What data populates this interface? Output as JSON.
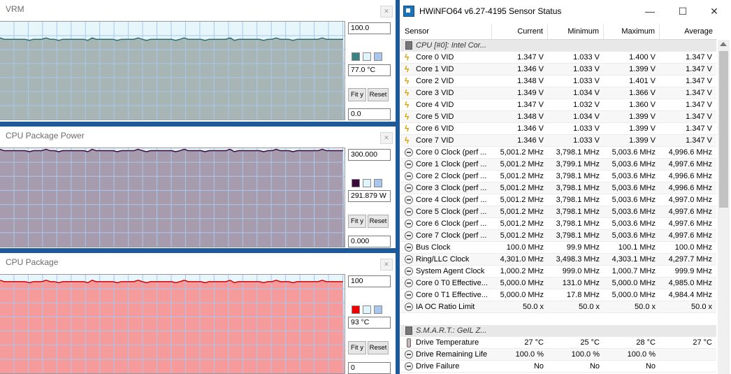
{
  "graphs": [
    {
      "title": "VRM",
      "max_box": "100.0",
      "cur_box": "77.0 °C",
      "min_box": "0.0",
      "fit_label": "Fit y",
      "reset_label": "Reset",
      "fill": "#a7b6b4",
      "line": "#2d6b68",
      "grid_bg": "#e6f6fb",
      "level": 0.82,
      "swatches": [
        "#3a8483",
        "#dff4fb",
        "#a9c7ee"
      ]
    },
    {
      "title": "CPU Package Power",
      "max_box": "300.000",
      "cur_box": "291.879 W",
      "min_box": "0.000",
      "fit_label": "Fit y",
      "reset_label": "Reset",
      "fill": "#a79cae",
      "line": "#3b0a3d",
      "grid_bg": "#e6f6fb",
      "level": 0.975,
      "swatches": [
        "#3b0a3d",
        "#dff4fb",
        "#a9c7ee"
      ]
    },
    {
      "title": "CPU Package",
      "max_box": "100",
      "cur_box": "93 °C",
      "min_box": "0",
      "fit_label": "Fit y",
      "reset_label": "Reset",
      "fill": "#f59b9b",
      "line": "#d10000",
      "grid_bg": "#e6f6fb",
      "level": 0.93,
      "swatches": [
        "#ee0000",
        "#dff4fb",
        "#a9c7ee"
      ]
    }
  ],
  "sensor": {
    "title": "HWiNFO64 v6.27-4195 Sensor Status",
    "columns": [
      "Sensor",
      "Current",
      "Minimum",
      "Maximum",
      "Average"
    ],
    "rows": [
      {
        "kind": "group",
        "icon": "chip",
        "name": "CPU [#0]: Intel Cor..."
      },
      {
        "kind": "row",
        "icon": "volt",
        "name": "Core 0 VID",
        "cur": "1.347 V",
        "min": "1.033 V",
        "max": "1.400 V",
        "avg": "1.347 V"
      },
      {
        "kind": "row",
        "icon": "volt",
        "name": "Core 1 VID",
        "cur": "1.346 V",
        "min": "1.033 V",
        "max": "1.399 V",
        "avg": "1.347 V"
      },
      {
        "kind": "row",
        "icon": "volt",
        "name": "Core 2 VID",
        "cur": "1.348 V",
        "min": "1.033 V",
        "max": "1.401 V",
        "avg": "1.347 V"
      },
      {
        "kind": "row",
        "icon": "volt",
        "name": "Core 3 VID",
        "cur": "1.349 V",
        "min": "1.034 V",
        "max": "1.366 V",
        "avg": "1.347 V"
      },
      {
        "kind": "row",
        "icon": "volt",
        "name": "Core 4 VID",
        "cur": "1.347 V",
        "min": "1.032 V",
        "max": "1.360 V",
        "avg": "1.347 V"
      },
      {
        "kind": "row",
        "icon": "volt",
        "name": "Core 5 VID",
        "cur": "1.348 V",
        "min": "1.034 V",
        "max": "1.399 V",
        "avg": "1.347 V"
      },
      {
        "kind": "row",
        "icon": "volt",
        "name": "Core 6 VID",
        "cur": "1.346 V",
        "min": "1.033 V",
        "max": "1.399 V",
        "avg": "1.347 V"
      },
      {
        "kind": "row",
        "icon": "volt",
        "name": "Core 7 VID",
        "cur": "1.346 V",
        "min": "1.033 V",
        "max": "1.399 V",
        "avg": "1.347 V"
      },
      {
        "kind": "row",
        "icon": "clock",
        "name": "Core 0 Clock (perf ...",
        "cur": "5,001.2 MHz",
        "min": "3,798.1 MHz",
        "max": "5,003.6 MHz",
        "avg": "4,996.6 MHz"
      },
      {
        "kind": "row",
        "icon": "clock",
        "name": "Core 1 Clock (perf ...",
        "cur": "5,001.2 MHz",
        "min": "3,799.1 MHz",
        "max": "5,003.6 MHz",
        "avg": "4,997.6 MHz"
      },
      {
        "kind": "row",
        "icon": "clock",
        "name": "Core 2 Clock (perf ...",
        "cur": "5,001.2 MHz",
        "min": "3,798.1 MHz",
        "max": "5,003.6 MHz",
        "avg": "4,996.6 MHz"
      },
      {
        "kind": "row",
        "icon": "clock",
        "name": "Core 3 Clock (perf ...",
        "cur": "5,001.2 MHz",
        "min": "3,798.1 MHz",
        "max": "5,003.6 MHz",
        "avg": "4,996.6 MHz"
      },
      {
        "kind": "row",
        "icon": "clock",
        "name": "Core 4 Clock (perf ...",
        "cur": "5,001.2 MHz",
        "min": "3,798.1 MHz",
        "max": "5,003.6 MHz",
        "avg": "4,997.0 MHz"
      },
      {
        "kind": "row",
        "icon": "clock",
        "name": "Core 5 Clock (perf ...",
        "cur": "5,001.2 MHz",
        "min": "3,798.1 MHz",
        "max": "5,003.6 MHz",
        "avg": "4,997.6 MHz"
      },
      {
        "kind": "row",
        "icon": "clock",
        "name": "Core 6 Clock (perf ...",
        "cur": "5,001.2 MHz",
        "min": "3,798.1 MHz",
        "max": "5,003.6 MHz",
        "avg": "4,997.6 MHz"
      },
      {
        "kind": "row",
        "icon": "clock",
        "name": "Core 7 Clock (perf ...",
        "cur": "5,001.2 MHz",
        "min": "3,798.1 MHz",
        "max": "5,003.6 MHz",
        "avg": "4,997.6 MHz"
      },
      {
        "kind": "row",
        "icon": "clock",
        "name": "Bus Clock",
        "cur": "100.0 MHz",
        "min": "99.9 MHz",
        "max": "100.1 MHz",
        "avg": "100.0 MHz"
      },
      {
        "kind": "row",
        "icon": "clock",
        "name": "Ring/LLC Clock",
        "cur": "4,301.0 MHz",
        "min": "3,498.3 MHz",
        "max": "4,303.1 MHz",
        "avg": "4,297.7 MHz"
      },
      {
        "kind": "row",
        "icon": "clock",
        "name": "System Agent Clock",
        "cur": "1,000.2 MHz",
        "min": "999.0 MHz",
        "max": "1,000.7 MHz",
        "avg": "999.9 MHz"
      },
      {
        "kind": "row",
        "icon": "clock",
        "name": "Core 0 T0 Effective...",
        "cur": "5,000.0 MHz",
        "min": "131.0 MHz",
        "max": "5,000.0 MHz",
        "avg": "4,985.0 MHz"
      },
      {
        "kind": "row",
        "icon": "clock",
        "name": "Core 0 T1 Effective...",
        "cur": "5,000.0 MHz",
        "min": "17.8 MHz",
        "max": "5,000.0 MHz",
        "avg": "4,984.4 MHz"
      },
      {
        "kind": "row",
        "icon": "clock",
        "name": "IA OC Ratio Limit",
        "cur": "50.0 x",
        "min": "50.0 x",
        "max": "50.0 x",
        "avg": "50.0 x"
      },
      {
        "kind": "blank"
      },
      {
        "kind": "group",
        "icon": "chip",
        "name": "S.M.A.R.T.: GeIL Z..."
      },
      {
        "kind": "row",
        "icon": "therm",
        "name": "Drive Temperature",
        "cur": "27 °C",
        "min": "25 °C",
        "max": "28 °C",
        "avg": "27 °C"
      },
      {
        "kind": "row",
        "icon": "clock",
        "name": "Drive Remaining Life",
        "cur": "100.0 %",
        "min": "100.0 %",
        "max": "100.0 %",
        "avg": ""
      },
      {
        "kind": "row",
        "icon": "clock",
        "name": "Drive Failure",
        "cur": "No",
        "min": "No",
        "max": "No",
        "avg": ""
      }
    ]
  }
}
